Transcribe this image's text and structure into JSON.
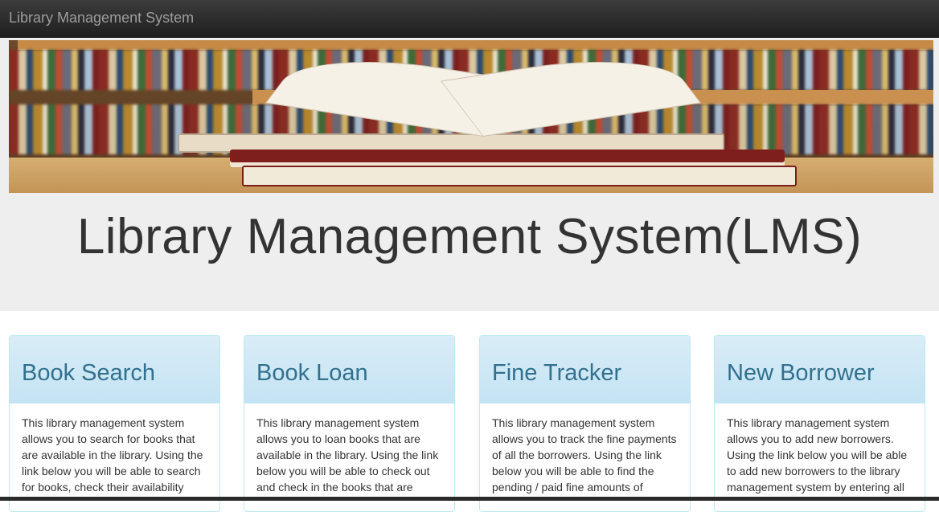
{
  "navbar": {
    "brand": "Library Management System"
  },
  "hero": {
    "title": "Library Management System(LMS)"
  },
  "panels": [
    {
      "title": "Book Search",
      "body": "This library management system allows you to search for books that are available in the library. Using the link below you will be able to search for books, check their availability"
    },
    {
      "title": "Book Loan",
      "body": "This library management system allows you to loan books that are available in the library. Using the link below you will be able to check out and check in the books that are"
    },
    {
      "title": "Fine Tracker",
      "body": "This library management system allows you to track the fine payments of all the borrowers. Using the link below you will be able to find the pending / paid fine amounts of"
    },
    {
      "title": "New Borrower",
      "body": "This library management system allows you to add new borrowers. Using the link below you will be able to add new borrowers to the library management system by entering all"
    }
  ],
  "colors": {
    "navbar": "#222222",
    "brand_text": "#9d9d9d",
    "jumbotron": "#eeeeee",
    "panel_heading": "#d9edf7",
    "panel_title": "#31708f",
    "panel_border": "#bce8f1"
  }
}
